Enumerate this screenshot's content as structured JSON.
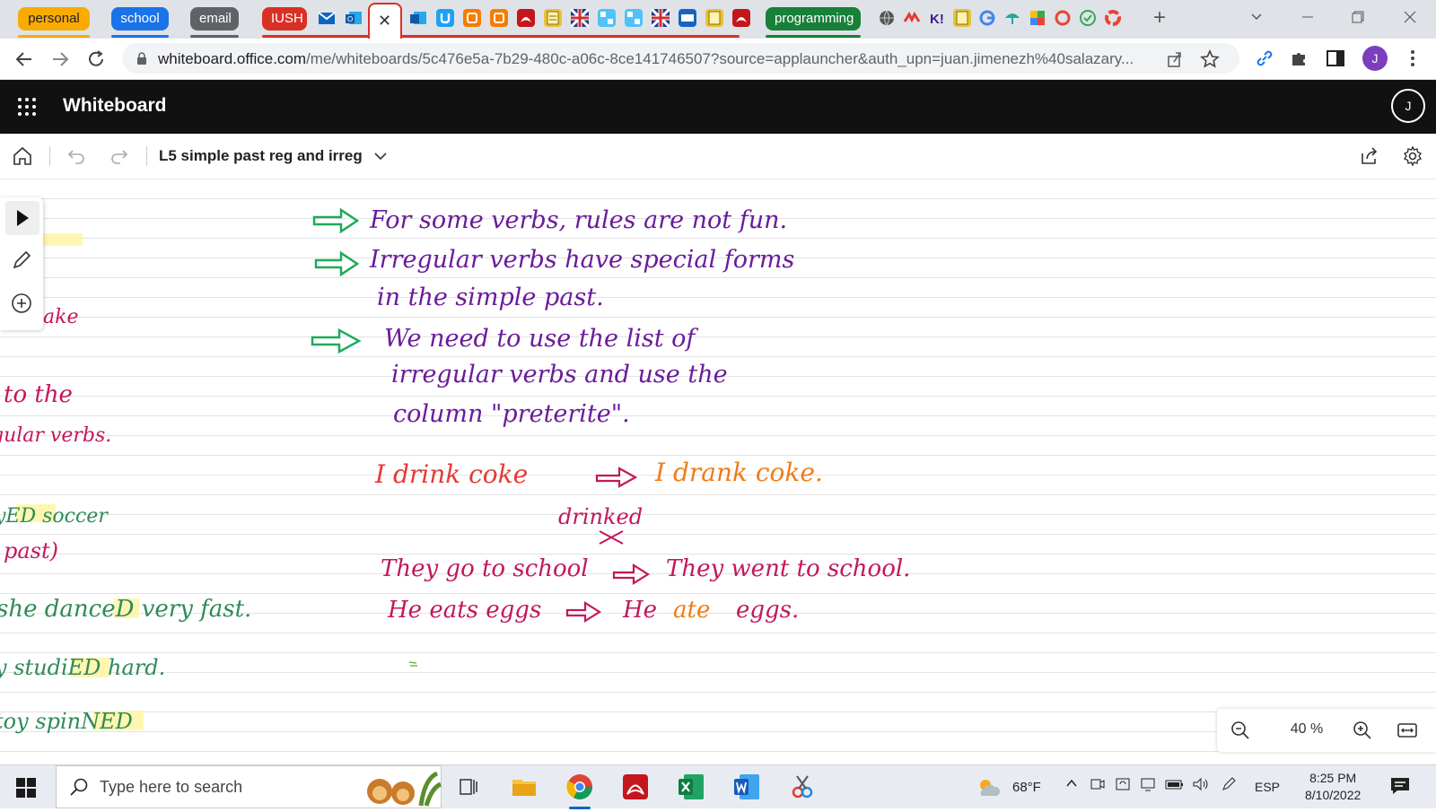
{
  "browser": {
    "tab_groups": [
      {
        "label": "personal",
        "color": "#f9ab00",
        "text_color": "#202124"
      },
      {
        "label": "school",
        "color": "#1a73e8",
        "text_color": "#ffffff"
      },
      {
        "label": "email",
        "color": "#5f6368",
        "text_color": "#ffffff"
      },
      {
        "label": "IUSH",
        "color": "#d93025",
        "text_color": "#ffffff"
      },
      {
        "label": "programming",
        "color": "#188038",
        "text_color": "#ffffff"
      }
    ],
    "new_tab_glyph": "+",
    "close_glyph": "✕",
    "url_host": "whiteboard.office.com",
    "url_path": "/me/whiteboards/5c476e5a-7b29-480c-a06c-8ce141746507?source=applauncher&auth_upn=juan.jimenezh%40salazary...",
    "profile_initial": "J"
  },
  "app": {
    "title": "Whiteboard",
    "account_initial": "J",
    "board_name": "L5 simple past reg and irreg"
  },
  "ink": {
    "left_partial": [
      {
        "text": "ake",
        "color": "#c2185b"
      },
      {
        "text": "to the",
        "color": "#c2185b"
      },
      {
        "text": "gular verbs.",
        "color": "#c2185b"
      },
      {
        "text": "yED soccer",
        "color": "#2e8b57"
      },
      {
        "text": "past)",
        "color": "#c2185b"
      },
      {
        "text": "she danceD very fast.",
        "color": "#2e8b57"
      },
      {
        "text": "y studiED hard.",
        "color": "#2e8b57"
      },
      {
        "text": "toy spinNED",
        "color": "#2e8b57"
      }
    ],
    "lines": [
      {
        "text": "For some verbs, rules are not fun.",
        "color": "#6a1b9a"
      },
      {
        "text": "Irregular verbs have special forms",
        "color": "#6a1b9a"
      },
      {
        "text": "in the simple past.",
        "color": "#6a1b9a"
      },
      {
        "text": "We need to use the list of",
        "color": "#6a1b9a"
      },
      {
        "text": "irregular verbs and use the",
        "color": "#6a1b9a"
      },
      {
        "text": "column \"preterite\".",
        "color": "#6a1b9a"
      }
    ],
    "example1_left": "I drink coke",
    "example1_right": "I drank coke.",
    "wrong_form": "drinked",
    "example2_left": "They go to school",
    "example2_right": "They went to school.",
    "example3_left": "He eats eggs",
    "example3_right_1": "He",
    "example3_right_2": "ate",
    "example3_right_3": "eggs.",
    "arrow_color": "#1faa59",
    "red_color": "#e53935",
    "orange_color": "#ef7d16",
    "magenta_color": "#c2185b"
  },
  "zoom": {
    "value": "40 %"
  },
  "taskbar": {
    "search_placeholder": "Type here to search",
    "weather": "68°F",
    "language": "ESP",
    "time": "8:25 PM",
    "date": "8/10/2022"
  }
}
